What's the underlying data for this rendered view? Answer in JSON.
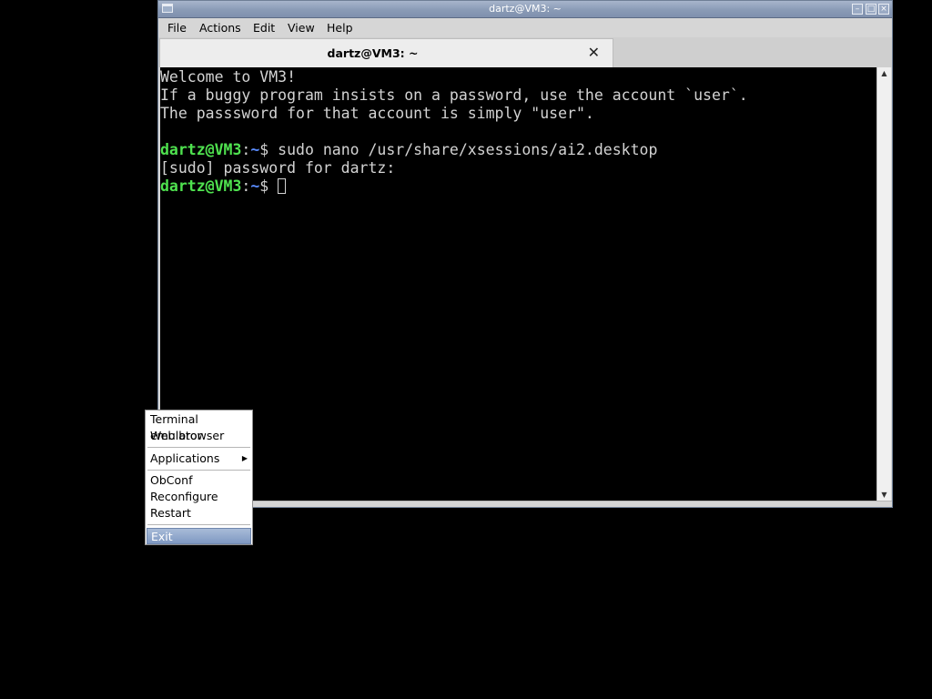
{
  "window": {
    "title": "dartz@VM3: ~",
    "controls": {
      "minimize_icon": "minimize-icon",
      "maximize_icon": "maximize-icon",
      "close_icon": "close-icon"
    }
  },
  "menubar": {
    "items": [
      "File",
      "Actions",
      "Edit",
      "View",
      "Help"
    ]
  },
  "tab": {
    "title": "dartz@VM3: ~",
    "close_glyph": "✕"
  },
  "terminal": {
    "lines": [
      {
        "text": "Welcome to VM3!"
      },
      {
        "text": "If a buggy program insists on a password, use the account `user`."
      },
      {
        "text": "The passsword for that account is simply \"user\"."
      },
      {
        "text": ""
      },
      {
        "prompt_user": "dartz@VM3",
        "prompt_sep": ":",
        "prompt_path": "~",
        "prompt_symbol": "$",
        "command": " sudo nano /usr/share/xsessions/ai2.desktop"
      },
      {
        "text": "[sudo] password for dartz:"
      },
      {
        "prompt_user": "dartz@VM3",
        "prompt_sep": ":",
        "prompt_path": "~",
        "prompt_symbol": "$",
        "command": " "
      }
    ],
    "colors": {
      "background": "#000000",
      "foreground": "#d3d3d3",
      "prompt_user": "#4fe24f",
      "prompt_path": "#5a8cff"
    }
  },
  "context_menu": {
    "items": [
      {
        "label": "Terminal emulator"
      },
      {
        "label": "Web browser"
      },
      {
        "label": "Applications",
        "submenu": true
      },
      {
        "label": "ObConf"
      },
      {
        "label": "Reconfigure"
      },
      {
        "label": "Restart"
      },
      {
        "label": "Exit",
        "highlighted": true
      }
    ],
    "submenu_icon": "chevron-right-icon"
  }
}
